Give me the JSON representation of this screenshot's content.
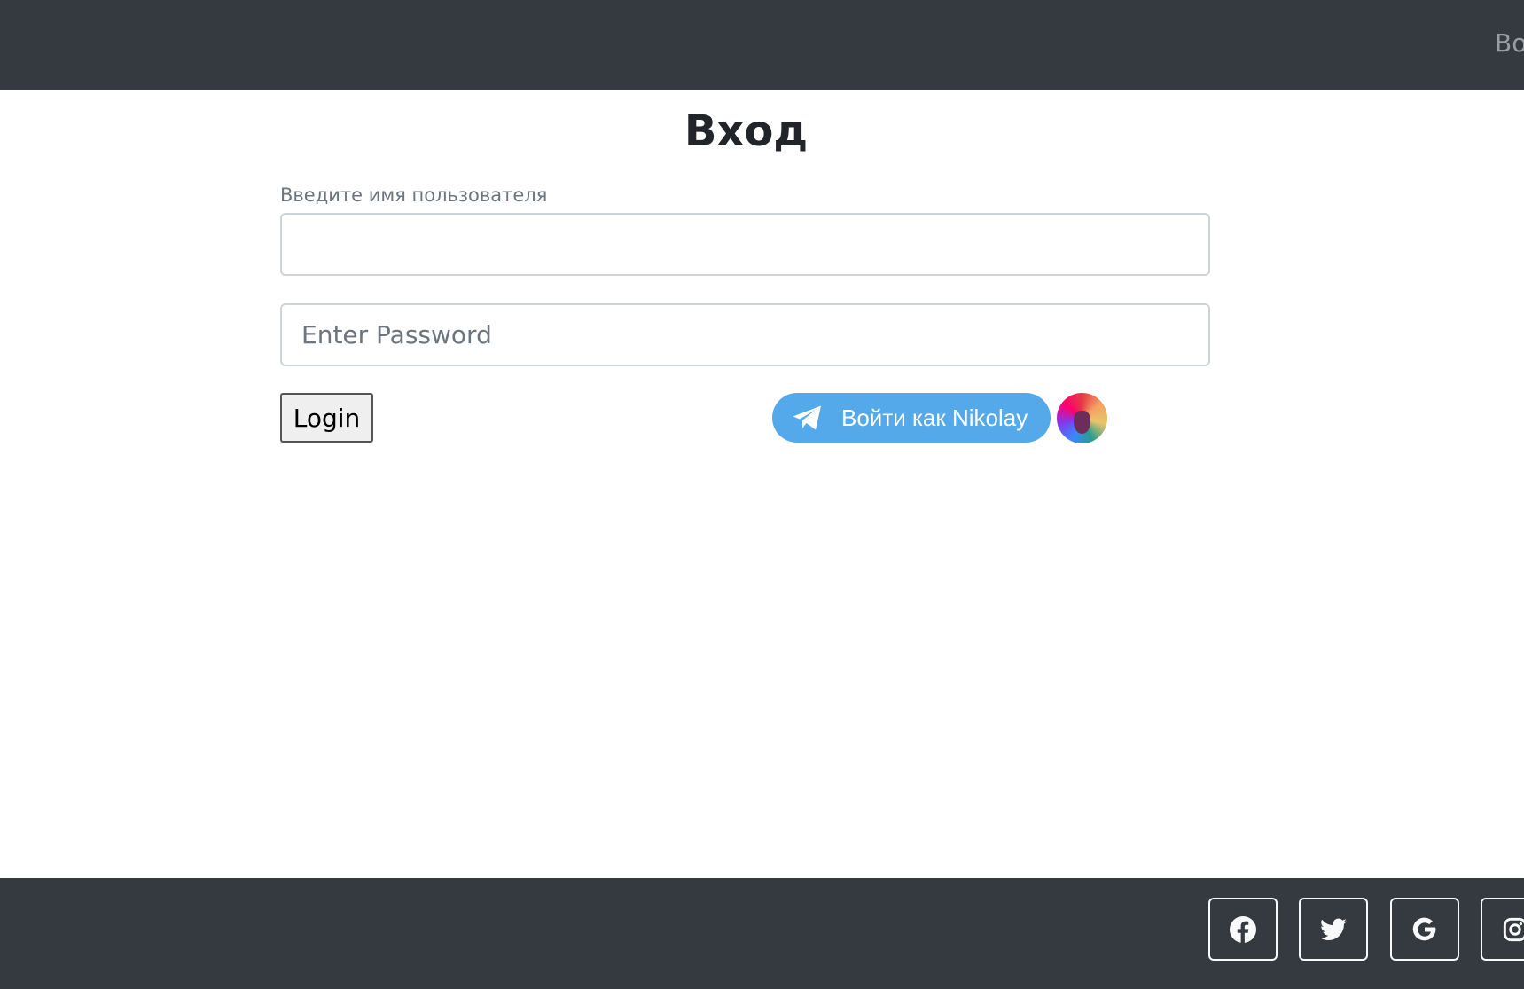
{
  "header": {
    "nav_link": "Во"
  },
  "main": {
    "title": "Вход",
    "username_label": "Введите имя пользователя",
    "username_value": "",
    "password_placeholder": "Enter Password",
    "login_button": "Login",
    "telegram_button": "Войти как Nikolay"
  },
  "footer": {
    "social": [
      "facebook-icon",
      "twitter-icon",
      "google-icon",
      "instagram-icon"
    ]
  },
  "colors": {
    "header_bg": "#343a40",
    "telegram": "#54a9eb"
  }
}
